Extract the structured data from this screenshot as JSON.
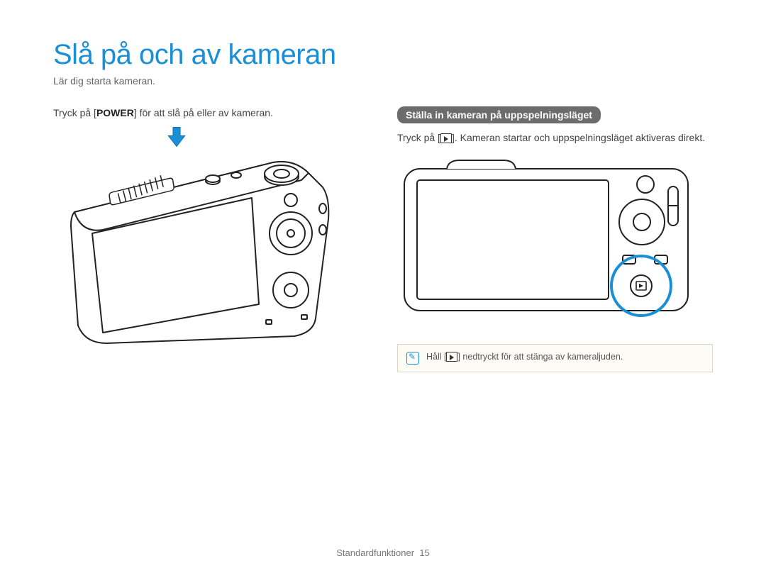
{
  "title": "Slå på och av kameran",
  "subtitle": "Lär dig starta kameran.",
  "left": {
    "instruction_pre": "Tryck på [",
    "instruction_bold": "POWER",
    "instruction_post": "] för att slå på eller av kameran."
  },
  "right": {
    "section_heading": "Ställa in kameran på uppspelningsläget",
    "para_pre": "Tryck på [",
    "para_post": "]. Kameran startar och uppspelningsläget aktiveras direkt.",
    "note_pre": "Håll [",
    "note_post": "] nedtryckt för att stänga av kameraljuden."
  },
  "footer": {
    "label": "Standardfunktioner",
    "page_number": "15"
  },
  "colors": {
    "accent": "#1b8fd6"
  }
}
